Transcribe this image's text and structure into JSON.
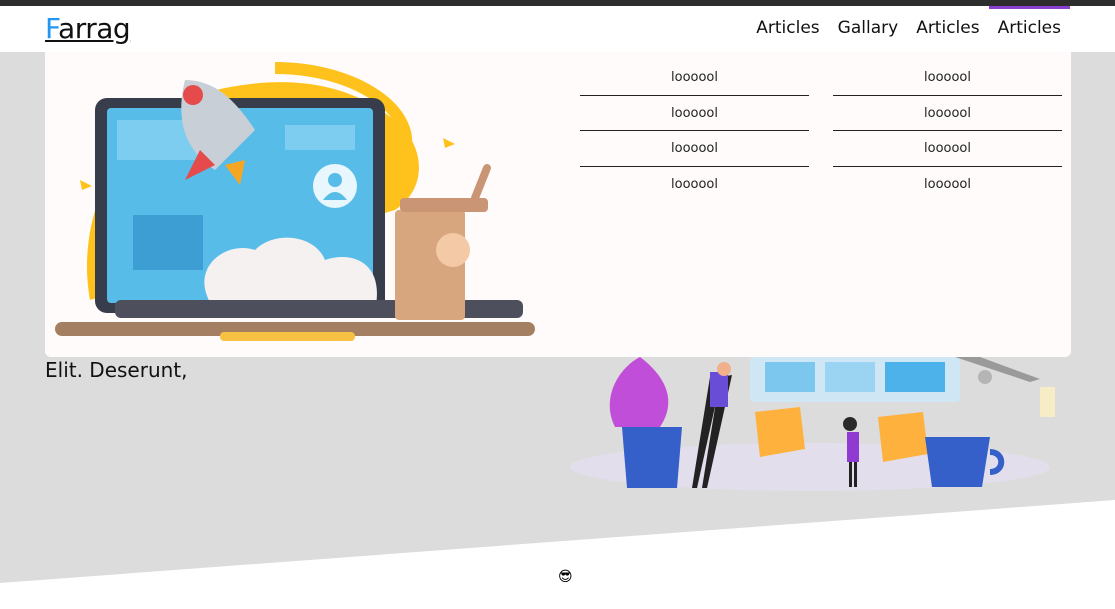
{
  "header": {
    "logo_first": "F",
    "logo_rest": "arrag",
    "nav": [
      {
        "label": "Articles",
        "active": false
      },
      {
        "label": "Gallary",
        "active": false
      },
      {
        "label": "Articles",
        "active": false
      },
      {
        "label": "Articles",
        "active": true
      }
    ]
  },
  "mega_menu": {
    "column1": [
      "loooool",
      "loooool",
      "loooool",
      "loooool"
    ],
    "column2": [
      "loooool",
      "loooool",
      "loooool",
      "loooool"
    ]
  },
  "landing": {
    "text_line2": "Elit. Deserunt,"
  },
  "footer": {
    "emoji": "😎"
  },
  "colors": {
    "accent": "#8a3fd1",
    "logo_first_letter": "#2196f3",
    "landing_bg": "#dcdcdc"
  },
  "icons": [
    "rocket-laptop-illustration",
    "team-board-illustration",
    "sunglasses-emoji"
  ]
}
